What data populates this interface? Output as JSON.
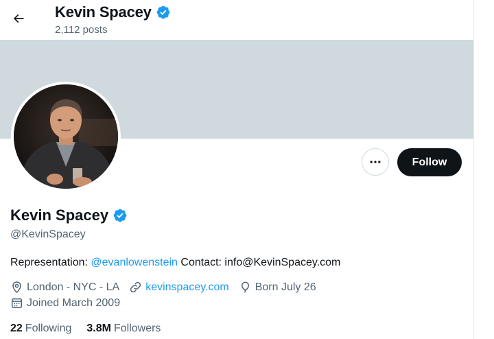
{
  "header": {
    "name": "Kevin Spacey",
    "posts": "2,112 posts"
  },
  "actions": {
    "follow_label": "Follow"
  },
  "profile": {
    "name": "Kevin Spacey",
    "handle": "@KevinSpacey",
    "bio_prefix": "Representation: ",
    "bio_mention": "@evanlowenstein",
    "bio_suffix": " Contact: info@KevinSpacey.com",
    "location": "London - NYC - LA",
    "website": "kevinspacey.com",
    "birthday": "Born July 26",
    "joined": "Joined March 2009"
  },
  "stats": {
    "following_count": "22",
    "following_label": "Following",
    "followers_count": "3.8M",
    "followers_label": "Followers"
  },
  "icons": {
    "back": "arrow-left-icon",
    "verified": "verified-badge-icon",
    "more": "more-horizontal-icon",
    "location": "location-pin-icon",
    "link": "link-icon",
    "birthday": "balloon-icon",
    "calendar": "calendar-icon"
  },
  "colors": {
    "accent": "#1d9bf0",
    "banner": "#cfd9de",
    "text_primary": "#0f1419",
    "text_secondary": "#536471",
    "follow_bg": "#0f1419"
  }
}
